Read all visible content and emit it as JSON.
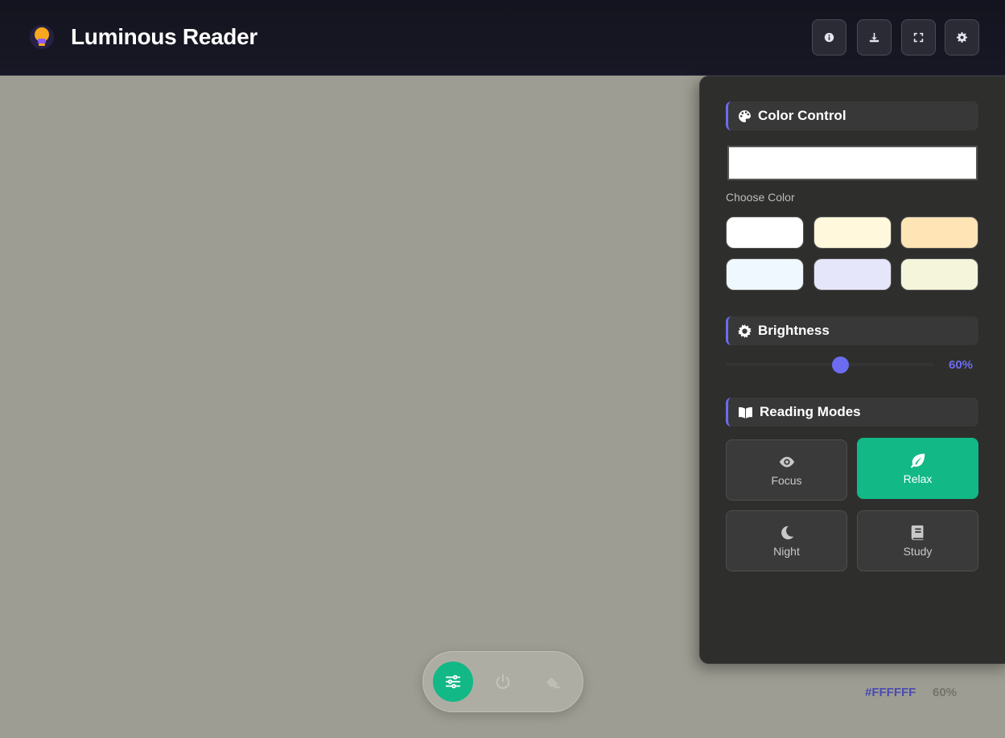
{
  "app": {
    "title": "Luminous Reader"
  },
  "header": {
    "buttons": [
      {
        "icon": "info-icon"
      },
      {
        "icon": "download-icon"
      },
      {
        "icon": "fullscreen-icon"
      },
      {
        "icon": "gear-icon"
      }
    ]
  },
  "panel": {
    "color_control": {
      "title": "Color Control",
      "color_value": "#FFFFFF",
      "choose_label": "Choose Color",
      "swatches": [
        "#FFFFFF",
        "#FFF8DC",
        "#FFE4B5",
        "#F0F8FF",
        "#E6E6FA",
        "#F5F5DC"
      ]
    },
    "brightness": {
      "title": "Brightness",
      "value": 60,
      "value_label": "60%"
    },
    "reading_modes": {
      "title": "Reading Modes",
      "modes": [
        {
          "label": "Focus",
          "icon": "eye-icon",
          "active": false
        },
        {
          "label": "Relax",
          "icon": "leaf-icon",
          "active": true
        },
        {
          "label": "Night",
          "icon": "moon-icon",
          "active": false
        },
        {
          "label": "Study",
          "icon": "book-icon",
          "active": false
        }
      ]
    }
  },
  "dock": {
    "buttons": [
      {
        "icon": "sliders-icon",
        "active": true
      },
      {
        "icon": "power-icon",
        "active": false
      },
      {
        "icon": "eraser-icon",
        "active": false
      }
    ]
  },
  "status": {
    "color": "#FFFFFF",
    "brightness": "60%"
  },
  "colors": {
    "accent": "#6C6CF0",
    "active_mode": "#12B886",
    "canvas": "#9D9D93"
  }
}
